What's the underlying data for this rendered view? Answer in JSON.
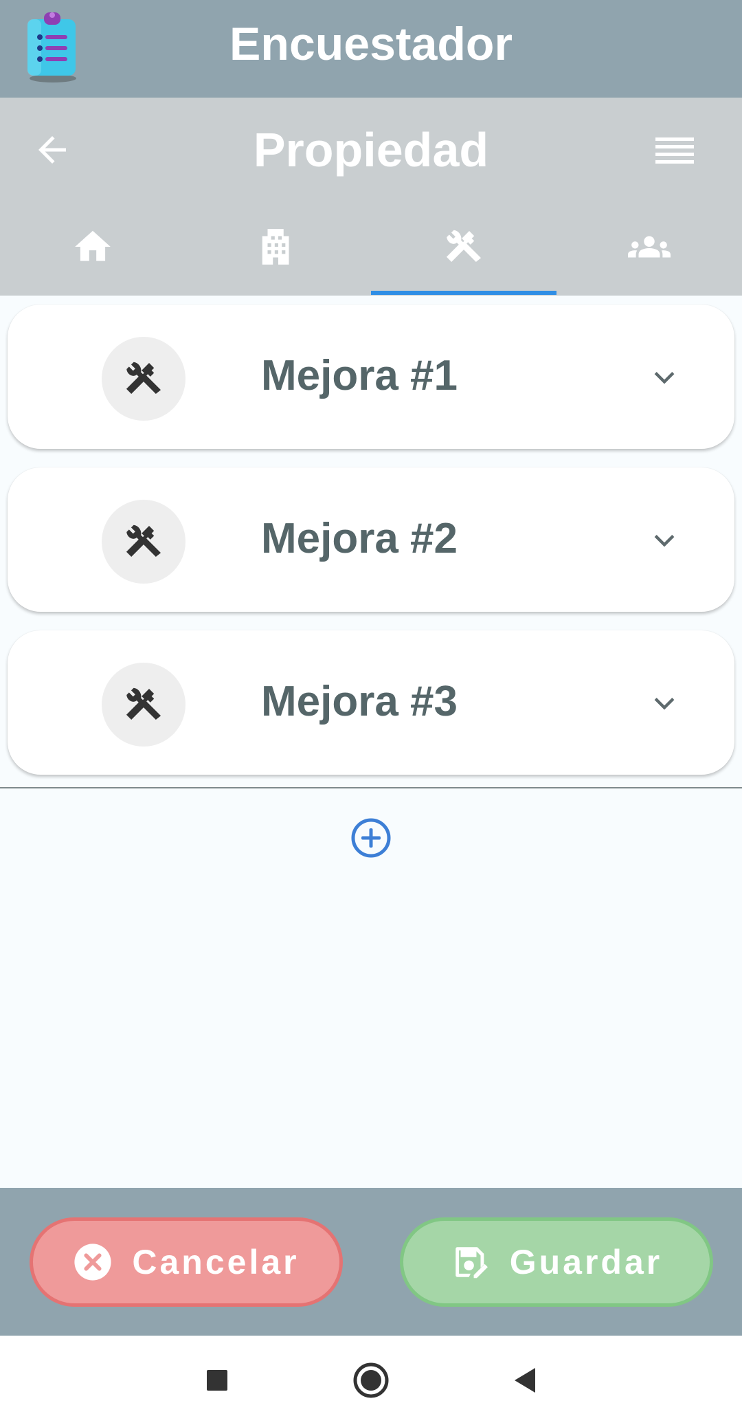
{
  "app": {
    "title": "Encuestador",
    "logo_icon": "clipboard-list-icon",
    "bar_color": "#90A4AE"
  },
  "header": {
    "title": "Propiedad",
    "back_icon": "arrow-left-icon",
    "menu_icon": "menu-lines-icon"
  },
  "tabs": [
    {
      "icon": "home-icon",
      "active": false
    },
    {
      "icon": "building-icon",
      "active": false
    },
    {
      "icon": "tools-icon",
      "active": true
    },
    {
      "icon": "people-icon",
      "active": false
    }
  ],
  "improvements": [
    {
      "label": "Mejora #1",
      "icon": "tools-icon",
      "expand_icon": "chevron-down-icon"
    },
    {
      "label": "Mejora #2",
      "icon": "tools-icon",
      "expand_icon": "chevron-down-icon"
    },
    {
      "label": "Mejora #3",
      "icon": "tools-icon",
      "expand_icon": "chevron-down-icon"
    }
  ],
  "add_button": {
    "icon": "plus-circle-icon",
    "color": "#3D7FD6"
  },
  "actions": {
    "cancel_label": "Cancelar",
    "cancel_icon": "close-circle-icon",
    "cancel_color": "#EF9A9A",
    "save_label": "Guardar",
    "save_icon": "save-edit-icon",
    "save_color": "#A5D6A7"
  },
  "system_nav": {
    "recents_icon": "square-icon",
    "home_icon": "circle-icon",
    "back_icon": "triangle-back-icon"
  },
  "colors": {
    "accent": "#2F8EE5",
    "header_bg": "#C9CED0",
    "card_text": "#556669",
    "page_bg": "#F8FCFE"
  }
}
